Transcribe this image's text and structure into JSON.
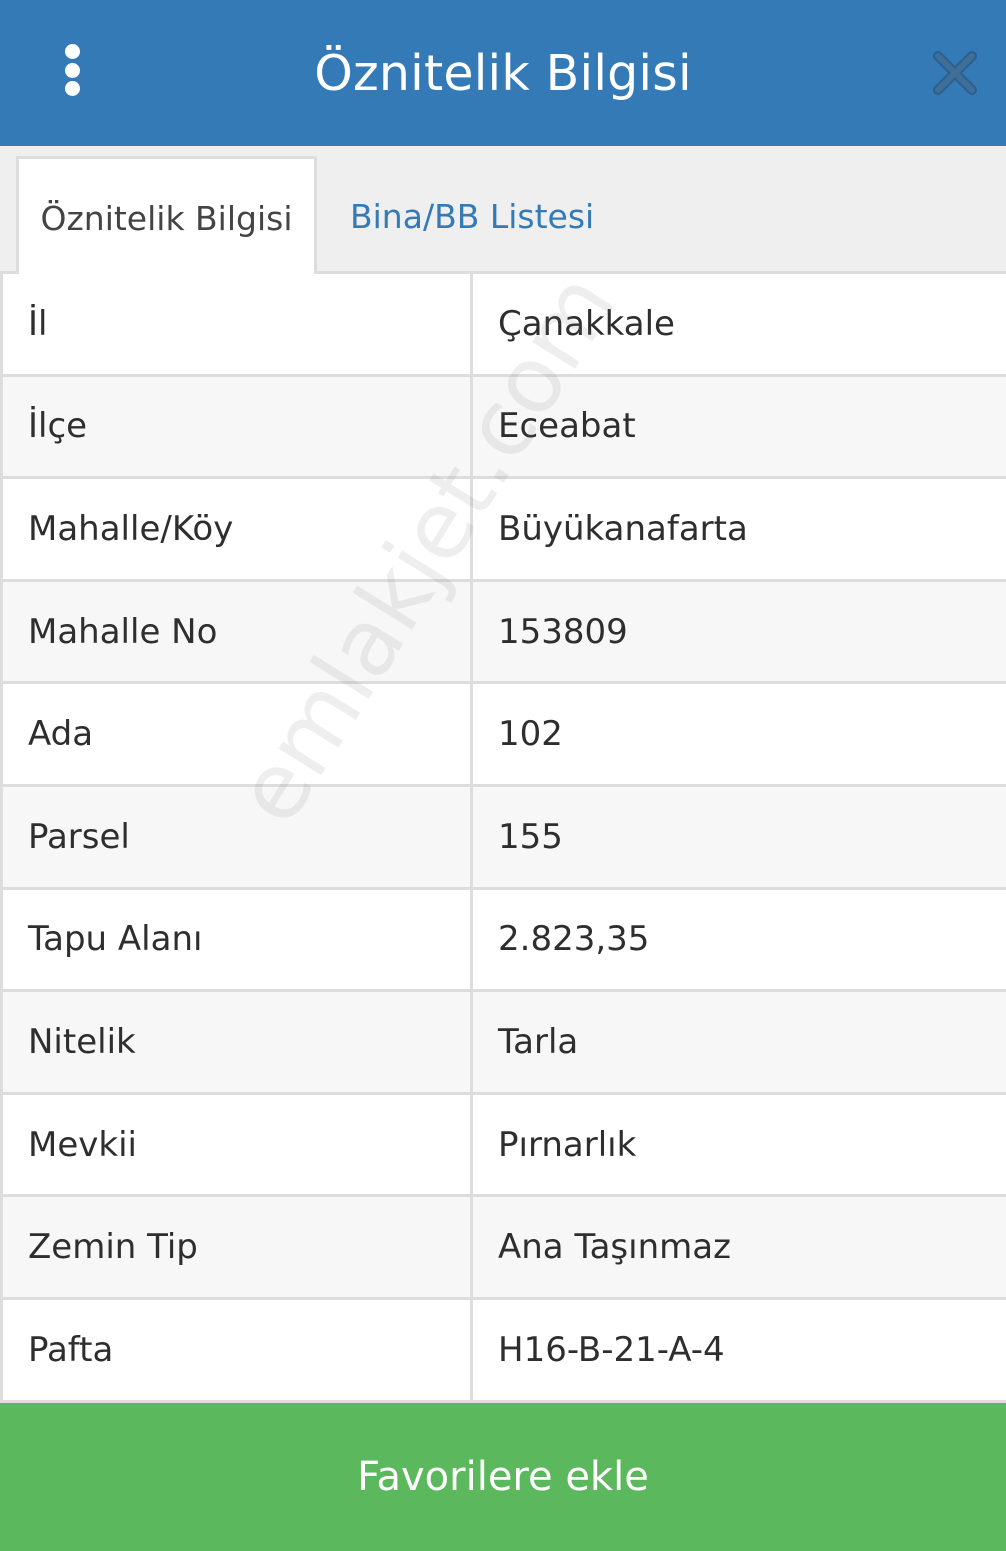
{
  "header": {
    "title": "Öznitelik Bilgisi",
    "menu_icon": "kebab-menu-icon",
    "close_icon": "close-icon"
  },
  "tabs": [
    {
      "label": "Öznitelik Bilgisi",
      "active": true
    },
    {
      "label": "Bina/BB Listesi",
      "active": false
    }
  ],
  "rows": [
    {
      "key": "İl",
      "value": "Çanakkale"
    },
    {
      "key": "İlçe",
      "value": "Eceabat"
    },
    {
      "key": "Mahalle/Köy",
      "value": "Büyükanafarta"
    },
    {
      "key": "Mahalle No",
      "value": "153809"
    },
    {
      "key": "Ada",
      "value": "102"
    },
    {
      "key": "Parsel",
      "value": "155"
    },
    {
      "key": "Tapu Alanı",
      "value": "2.823,35"
    },
    {
      "key": "Nitelik",
      "value": "Tarla"
    },
    {
      "key": "Mevkii",
      "value": "Pırnarlık"
    },
    {
      "key": "Zemin Tip",
      "value": "Ana Taşınmaz"
    },
    {
      "key": "Pafta",
      "value": "H16-B-21-A-4"
    }
  ],
  "watermark": "emlakjet.com",
  "footer": {
    "button_label": "Favorilere ekle"
  },
  "colors": {
    "header_bg": "#337ab7",
    "tab_link": "#337ab7",
    "footer_bg": "#5cb85c"
  }
}
